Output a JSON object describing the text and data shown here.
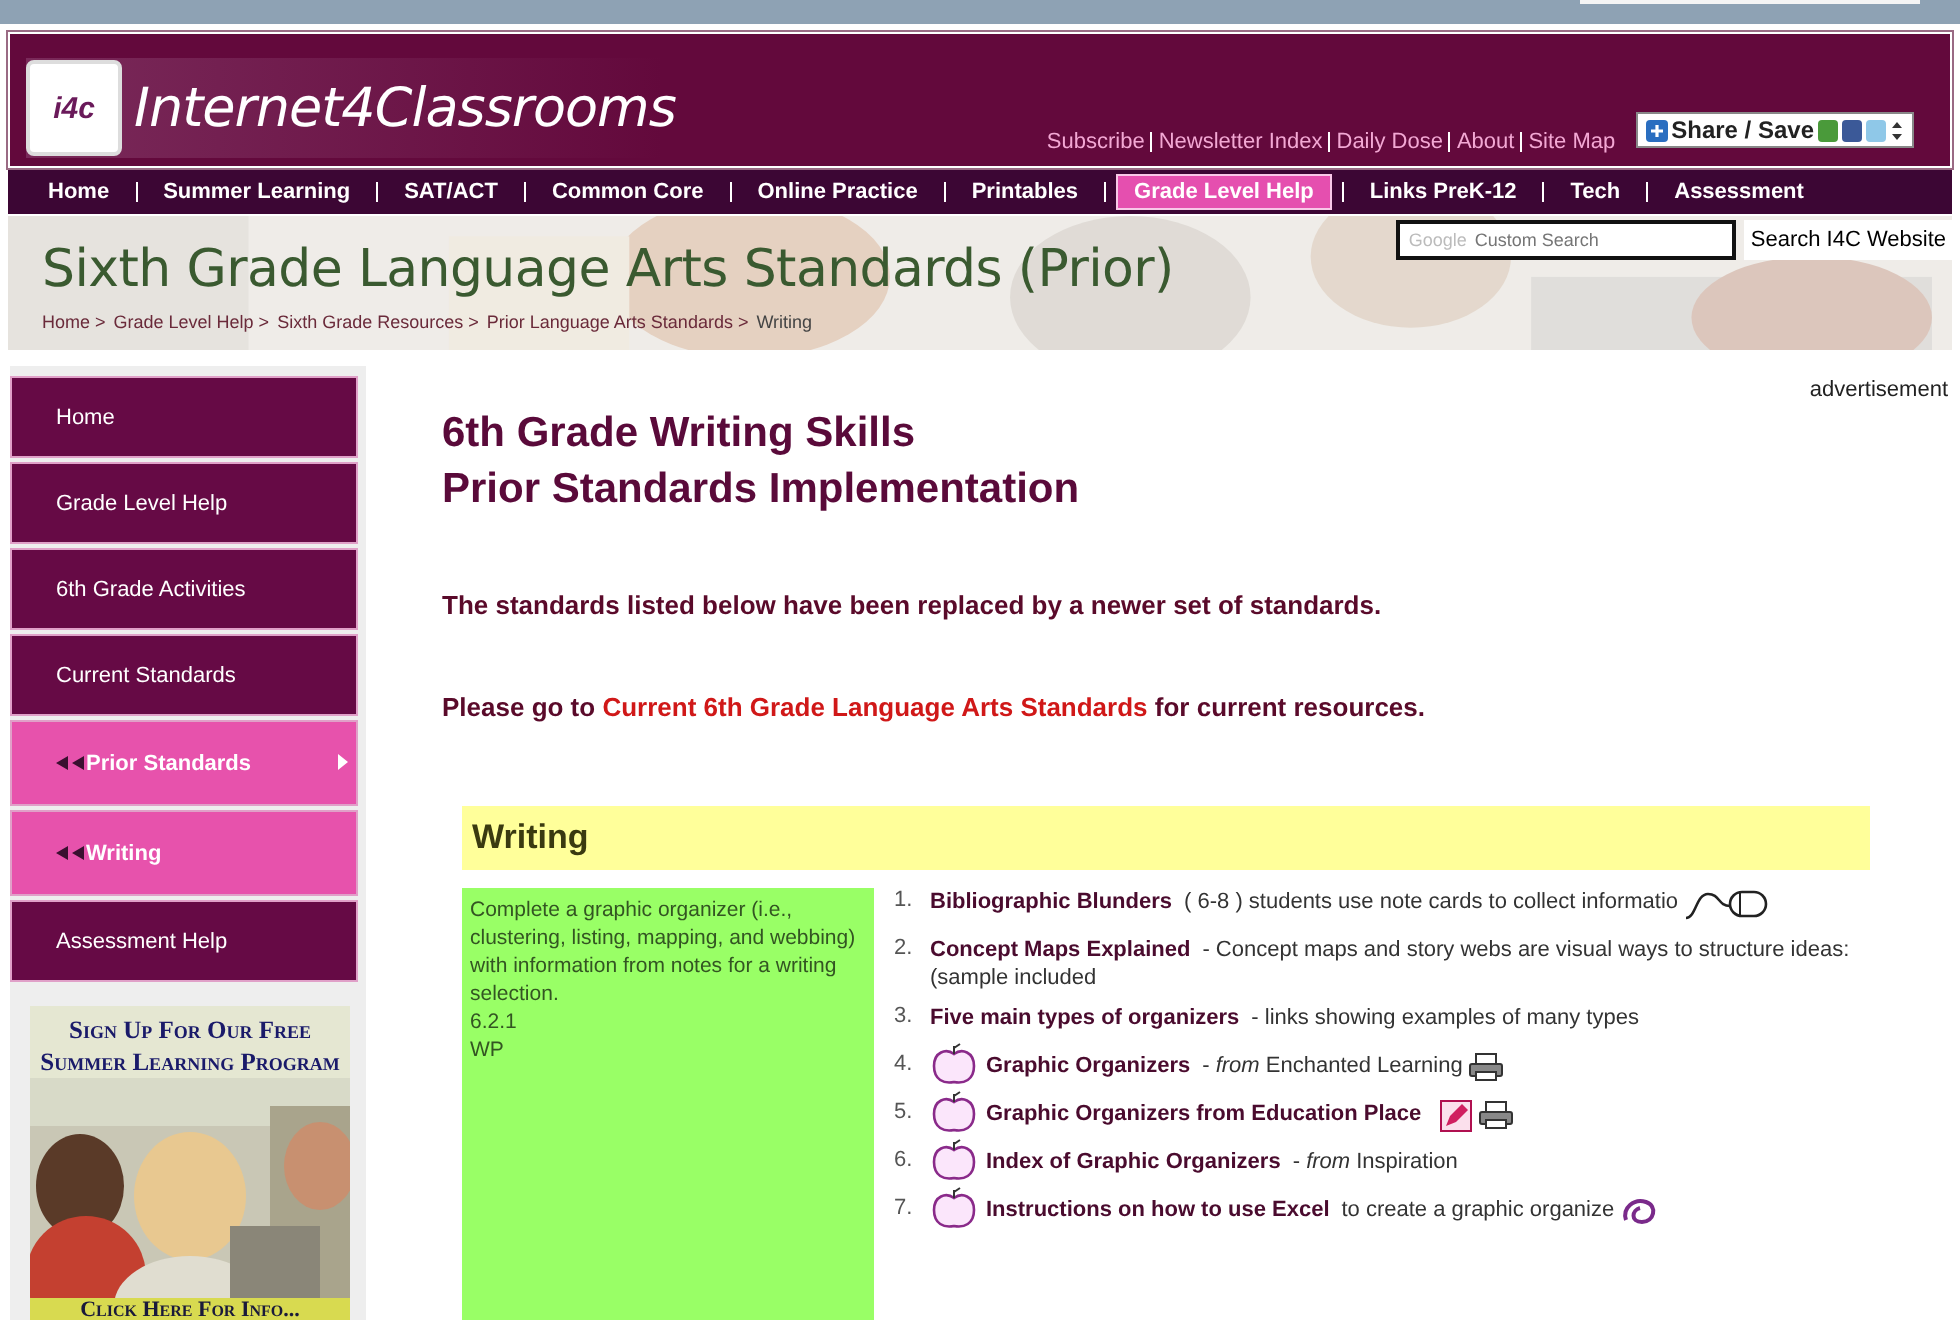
{
  "header": {
    "logo_mark": "i4c",
    "site_name": "Internet4Classrooms",
    "top_links": [
      "Subscribe",
      "Newsletter Index",
      "Daily Dose",
      "About",
      "Site Map"
    ],
    "share_button": "Share / Save"
  },
  "nav": [
    {
      "label": "Home",
      "selected": false
    },
    {
      "label": "Summer Learning",
      "selected": false
    },
    {
      "label": "SAT/ACT",
      "selected": false
    },
    {
      "label": "Common Core",
      "selected": false
    },
    {
      "label": "Online Practice",
      "selected": false
    },
    {
      "label": "Printables",
      "selected": false
    },
    {
      "label": "Grade Level Help",
      "selected": true
    },
    {
      "label": "Links PreK-12",
      "selected": false
    },
    {
      "label": "Tech",
      "selected": false
    },
    {
      "label": "Assessment",
      "selected": false
    }
  ],
  "banner": {
    "title": "Sixth Grade Language Arts Standards (Prior)",
    "search": {
      "prefix": "Google",
      "placeholder": "Custom Search"
    },
    "search_button": "Search I4C Website",
    "breadcrumbs": [
      "Home >",
      "Grade Level Help >",
      "Sixth Grade Resources >",
      "Prior Language Arts Standards >",
      "Writing"
    ]
  },
  "sidebar": {
    "items": [
      {
        "label": "Home",
        "selected": false
      },
      {
        "label": "Grade Level Help",
        "selected": false
      },
      {
        "label": "6th Grade Activities",
        "selected": false
      },
      {
        "label": "Current Standards",
        "selected": false
      },
      {
        "label": "Prior Standards",
        "selected": true,
        "expanded": true
      },
      {
        "label": "Writing",
        "selected": true,
        "expanded": false
      },
      {
        "label": "Assessment Help",
        "selected": false
      }
    ],
    "ad": {
      "kind": "picture",
      "headline": "Sign Up For Our Free Summer Learning Program",
      "cta": "Click Here For Info..."
    }
  },
  "main": {
    "advertisement_label": "advertisement",
    "title_lines": [
      "6th Grade Writing Skills",
      "Prior Standards Implementation"
    ],
    "notice": "The standards listed below have been replaced by a newer set of standards.",
    "redirect": {
      "before": "Please go to",
      "link": "Current 6th Grade Language Arts Standards",
      "after": "for current resources."
    },
    "section": {
      "heading": "Writing",
      "standard": [
        "Complete a graphic organizer (i.e., clustering, listing, mapping, and webbing) with information from notes for a writing selection.",
        "6.2.1",
        "WP"
      ],
      "resources": [
        {
          "number": "1.",
          "kind": "mouse",
          "link": "Bibliographic Blunders",
          "description": "( 6-8 ) students use note cards to collect informatio"
        },
        {
          "number": "2.",
          "kind": "plain",
          "link": "Concept Maps Explained",
          "description": "- Concept maps and story webs are visual ways to structure ideas: (sample included"
        },
        {
          "number": "3.",
          "kind": "plain",
          "link": "Five main types of organizers",
          "description": "- links showing examples of many types"
        },
        {
          "number": "4.",
          "kind": "printer",
          "link": "Graphic Organizers",
          "description": "- *from* Enchanted Learning"
        },
        {
          "number": "5.",
          "kind": "pencil",
          "link": "Graphic Organizers from Education Place"
        },
        {
          "number": "6.",
          "kind": "apple",
          "link": "Index of Graphic Organizers",
          "description": "- *from* Inspiration"
        },
        {
          "number": "7.",
          "kind": "swirl",
          "link": "Instructions on how to use Excel",
          "description": "to create a graphic organize"
        }
      ]
    }
  }
}
